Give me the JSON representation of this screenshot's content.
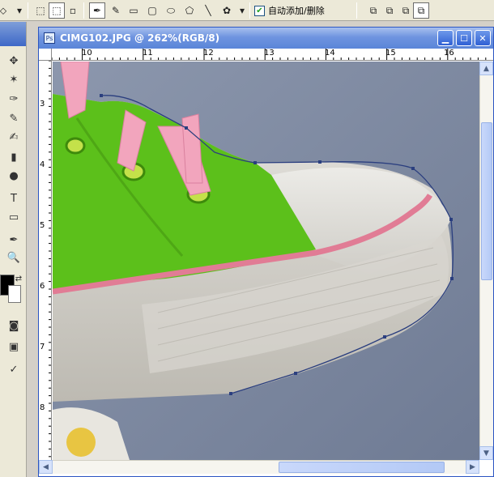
{
  "options_bar": {
    "auto_add_delete_label": "自动添加/删除",
    "auto_add_delete_checked": true,
    "icons": [
      "shape-layers-icon",
      "paths-icon",
      "fill-pixels-icon",
      "pen-icon",
      "freeform-pen-icon",
      "rectangle-icon",
      "rounded-rectangle-icon",
      "ellipse-icon",
      "polygon-icon",
      "line-icon",
      "custom-shape-icon",
      "add-to-area-icon",
      "subtract-area-icon",
      "intersect-area-icon",
      "exclude-overlap-icon"
    ]
  },
  "document": {
    "title": "CIMG102.JPG @ 262%(RGB/8)",
    "ruler_top_labels": [
      "10",
      "11",
      "12",
      "13",
      "14",
      "15",
      "16"
    ],
    "ruler_left_labels": [
      "3",
      "4",
      "5",
      "6",
      "7",
      "8"
    ]
  },
  "colors": {
    "background_swatch": "#ffffff",
    "foreground_swatch": "#000000",
    "title_bar": "#5a85d8"
  }
}
